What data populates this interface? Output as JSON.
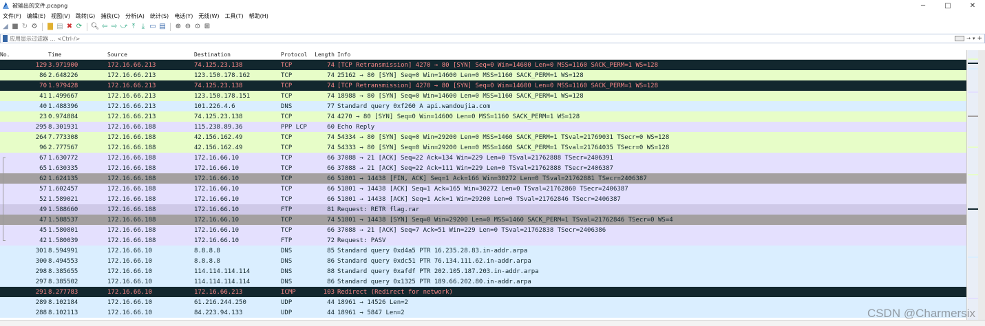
{
  "window": {
    "title": "被输出的文件.pcapng",
    "minimize": "─",
    "maximize": "□",
    "close": "✕"
  },
  "menu": [
    "文件(F)",
    "编辑(E)",
    "视图(V)",
    "跳转(G)",
    "捕获(C)",
    "分析(A)",
    "统计(S)",
    "电话(Y)",
    "无线(W)",
    "工具(T)",
    "帮助(H)"
  ],
  "filter": {
    "placeholder": "应用显示过滤器 … <Ctrl-/>",
    "value": ""
  },
  "columns": {
    "no": "No.",
    "time": "Time",
    "source": "Source",
    "destination": "Destination",
    "protocol": "Protocol",
    "length": "Length",
    "info": "Info"
  },
  "colors": {
    "bad_bg": "#12272e",
    "bad_fg": "#f78787",
    "tcp_green": "#e7fdc8",
    "lavender": "#e4e0fe",
    "udp_blue": "#daeeff",
    "grey": "#a4a0a0"
  },
  "packets": [
    {
      "no": "129",
      "time": "3.971900",
      "src": "172.16.66.213",
      "dst": "74.125.23.138",
      "proto": "TCP",
      "len": "74",
      "info": "[TCP Retransmission] 4270 → 80 [SYN] Seq=0 Win=14600 Len=0 MSS=1160 SACK_PERM=1 WS=128",
      "style": "bad",
      "gut": ""
    },
    {
      "no": "86",
      "time": "2.648226",
      "src": "172.16.66.213",
      "dst": "123.150.178.162",
      "proto": "TCP",
      "len": "74",
      "info": "25162 → 80 [SYN] Seq=0 Win=14600 Len=0 MSS=1160 SACK_PERM=1 WS=128",
      "style": "green",
      "gut": ""
    },
    {
      "no": "70",
      "time": "1.979428",
      "src": "172.16.66.213",
      "dst": "74.125.23.138",
      "proto": "TCP",
      "len": "74",
      "info": "[TCP Retransmission] 4270 → 80 [SYN] Seq=0 Win=14600 Len=0 MSS=1160 SACK_PERM=1 WS=128",
      "style": "bad",
      "gut": ""
    },
    {
      "no": "41",
      "time": "1.499667",
      "src": "172.16.66.213",
      "dst": "123.150.178.151",
      "proto": "TCP",
      "len": "74",
      "info": "18988 → 80 [SYN] Seq=0 Win=14600 Len=0 MSS=1160 SACK_PERM=1 WS=128",
      "style": "green",
      "gut": ""
    },
    {
      "no": "40",
      "time": "1.488396",
      "src": "172.16.66.213",
      "dst": "101.226.4.6",
      "proto": "DNS",
      "len": "77",
      "info": "Standard query 0xf260 A api.wandoujia.com",
      "style": "blue",
      "gut": ""
    },
    {
      "no": "23",
      "time": "0.974884",
      "src": "172.16.66.213",
      "dst": "74.125.23.138",
      "proto": "TCP",
      "len": "74",
      "info": "4270 → 80 [SYN] Seq=0 Win=14600 Len=0 MSS=1160 SACK_PERM=1 WS=128",
      "style": "green",
      "gut": ""
    },
    {
      "no": "295",
      "time": "8.301931",
      "src": "172.16.66.188",
      "dst": "115.238.89.36",
      "proto": "PPP LCP",
      "len": "60",
      "info": "Echo Reply",
      "style": "lav",
      "gut": ""
    },
    {
      "no": "264",
      "time": "7.773308",
      "src": "172.16.66.188",
      "dst": "42.156.162.49",
      "proto": "TCP",
      "len": "74",
      "info": "54334 → 80 [SYN] Seq=0 Win=29200 Len=0 MSS=1460 SACK_PERM=1 TSval=21769031 TSecr=0 WS=128",
      "style": "green",
      "gut": ""
    },
    {
      "no": "96",
      "time": "2.777567",
      "src": "172.16.66.188",
      "dst": "42.156.162.49",
      "proto": "TCP",
      "len": "74",
      "info": "54333 → 80 [SYN] Seq=0 Win=29200 Len=0 MSS=1460 SACK_PERM=1 TSval=21764035 TSecr=0 WS=128",
      "style": "green",
      "gut": ""
    },
    {
      "no": "67",
      "time": "1.630772",
      "src": "172.16.66.188",
      "dst": "172.16.66.10",
      "proto": "TCP",
      "len": "66",
      "info": "37088 → 21 [ACK] Seq=22 Ack=134 Win=229 Len=0 TSval=21762888 TSecr=2406391",
      "style": "lav",
      "gut": "end"
    },
    {
      "no": "65",
      "time": "1.630335",
      "src": "172.16.66.188",
      "dst": "172.16.66.10",
      "proto": "TCP",
      "len": "66",
      "info": "37088 → 21 [ACK] Seq=22 Ack=111 Win=229 Len=0 TSval=21762888 TSecr=2406387",
      "style": "lav",
      "gut": "line"
    },
    {
      "no": "62",
      "time": "1.624135",
      "src": "172.16.66.188",
      "dst": "172.16.66.10",
      "proto": "TCP",
      "len": "66",
      "info": "51801 → 14438 [FIN, ACK] Seq=1 Ack=166 Win=30272 Len=0 TSval=21762881 TSecr=2406387",
      "style": "grey",
      "gut": "line"
    },
    {
      "no": "57",
      "time": "1.602457",
      "src": "172.16.66.188",
      "dst": "172.16.66.10",
      "proto": "TCP",
      "len": "66",
      "info": "51801 → 14438 [ACK] Seq=1 Ack=165 Win=30272 Len=0 TSval=21762860 TSecr=2406387",
      "style": "lav",
      "gut": "line"
    },
    {
      "no": "52",
      "time": "1.589021",
      "src": "172.16.66.188",
      "dst": "172.16.66.10",
      "proto": "TCP",
      "len": "66",
      "info": "51801 → 14438 [ACK] Seq=1 Ack=1 Win=29200 Len=0 TSval=21762846 TSecr=2406387",
      "style": "lav",
      "gut": "line"
    },
    {
      "no": "49",
      "time": "1.588660",
      "src": "172.16.66.188",
      "dst": "172.16.66.10",
      "proto": "FTP",
      "len": "81",
      "info": "Request: RETR flag.rar",
      "style": "purple",
      "gut": "line"
    },
    {
      "no": "47",
      "time": "1.588537",
      "src": "172.16.66.188",
      "dst": "172.16.66.10",
      "proto": "TCP",
      "len": "74",
      "info": "51801 → 14438 [SYN] Seq=0 Win=29200 Len=0 MSS=1460 SACK_PERM=1 TSval=21762846 TSecr=0 WS=4",
      "style": "grey",
      "gut": "line"
    },
    {
      "no": "45",
      "time": "1.580801",
      "src": "172.16.66.188",
      "dst": "172.16.66.10",
      "proto": "TCP",
      "len": "66",
      "info": "37088 → 21 [ACK] Seq=7 Ack=51 Win=229 Len=0 TSval=21762838 TSecr=2406386",
      "style": "lav",
      "gut": "line"
    },
    {
      "no": "42",
      "time": "1.580039",
      "src": "172.16.66.188",
      "dst": "172.16.66.10",
      "proto": "FTP",
      "len": "72",
      "info": "Request: PASV",
      "style": "lav",
      "gut": "start"
    },
    {
      "no": "301",
      "time": "8.594991",
      "src": "172.16.66.10",
      "dst": "8.8.8.8",
      "proto": "DNS",
      "len": "85",
      "info": "Standard query 0xd4a5 PTR 16.235.28.83.in-addr.arpa",
      "style": "blue",
      "gut": ""
    },
    {
      "no": "300",
      "time": "8.494553",
      "src": "172.16.66.10",
      "dst": "8.8.8.8",
      "proto": "DNS",
      "len": "86",
      "info": "Standard query 0xdc51 PTR 76.134.111.62.in-addr.arpa",
      "style": "blue",
      "gut": ""
    },
    {
      "no": "298",
      "time": "8.385655",
      "src": "172.16.66.10",
      "dst": "114.114.114.114",
      "proto": "DNS",
      "len": "88",
      "info": "Standard query 0xafdf PTR 202.105.187.203.in-addr.arpa",
      "style": "blue",
      "gut": ""
    },
    {
      "no": "297",
      "time": "8.385502",
      "src": "172.16.66.10",
      "dst": "114.114.114.114",
      "proto": "DNS",
      "len": "86",
      "info": "Standard query 0x1325 PTR 189.66.202.80.in-addr.arpa",
      "style": "blue",
      "gut": ""
    },
    {
      "no": "291",
      "time": "8.277783",
      "src": "172.16.66.10",
      "dst": "172.16.66.213",
      "proto": "ICMP",
      "len": "103",
      "info": "Redirect             (Redirect for network)",
      "style": "bad",
      "gut": ""
    },
    {
      "no": "289",
      "time": "8.102184",
      "src": "172.16.66.10",
      "dst": "61.216.244.250",
      "proto": "UDP",
      "len": "44",
      "info": "18961 → 14526 Len=2",
      "style": "blue",
      "gut": ""
    },
    {
      "no": "288",
      "time": "8.102113",
      "src": "172.16.66.10",
      "dst": "84.223.94.133",
      "proto": "UDP",
      "len": "44",
      "info": "18961 → 5847 Len=2",
      "style": "blue",
      "gut": ""
    }
  ],
  "watermark": "CSDN @Charmersix"
}
